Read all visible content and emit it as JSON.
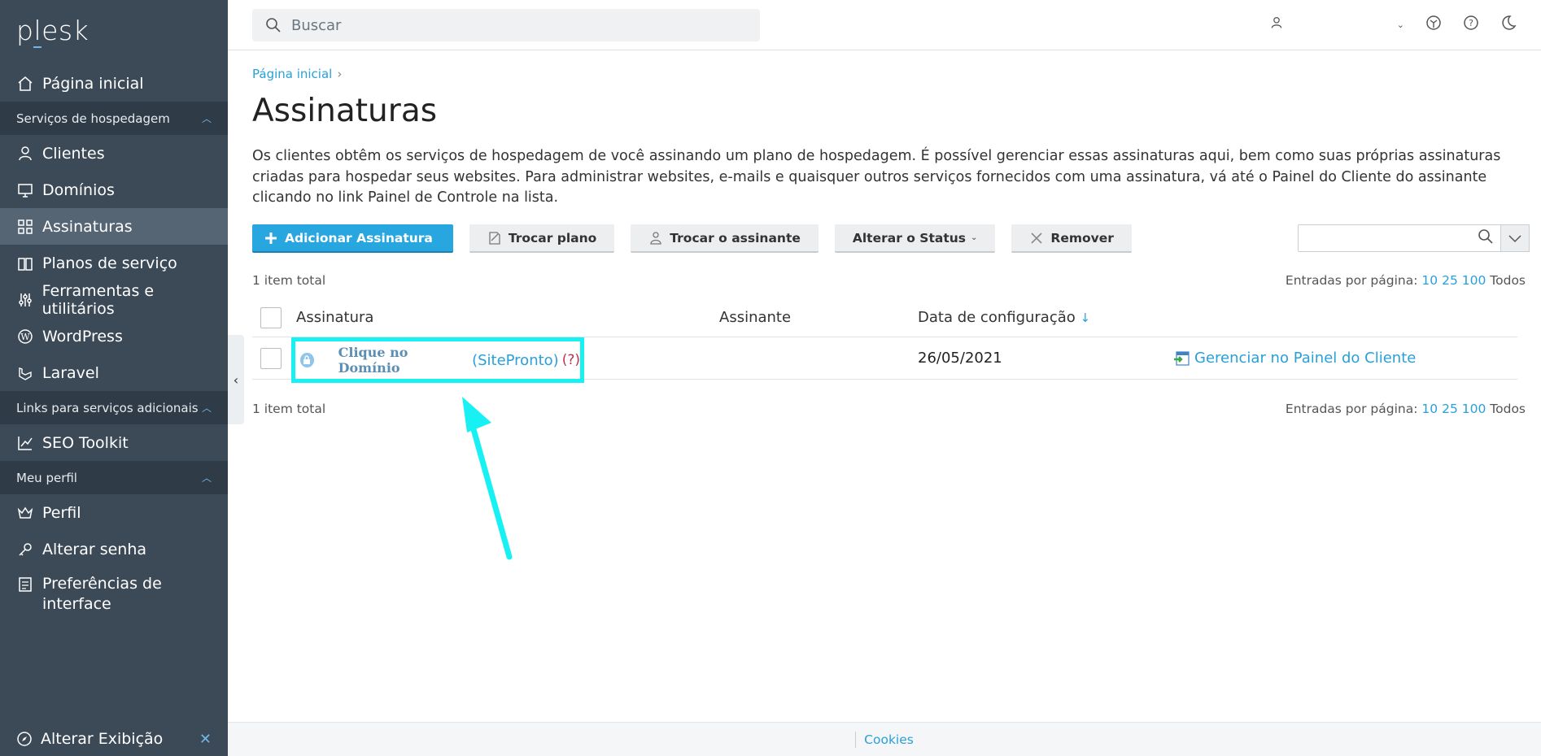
{
  "app": {
    "logo": "plesk"
  },
  "search": {
    "placeholder": "Buscar"
  },
  "sidebar": {
    "home": "Página inicial",
    "group_hosting": "Serviços de hospedagem",
    "clients": "Clientes",
    "domains": "Domínios",
    "subscriptions": "Assinaturas",
    "service_plans": "Planos de serviço",
    "tools": "Ferramentas e utilitários",
    "wordpress": "WordPress",
    "laravel": "Laravel",
    "group_links": "Links para serviços adicionais",
    "seo": "SEO Toolkit",
    "group_profile": "Meu perfil",
    "profile": "Perfil",
    "password": "Alterar senha",
    "prefs_line1": "Preferências de",
    "prefs_line2": "interface",
    "change_view": "Alterar Exibição"
  },
  "breadcrumb": {
    "home": "Página inicial"
  },
  "page": {
    "title": "Assinaturas",
    "description": "Os clientes obtêm os serviços de hospedagem de você assinando um plano de hospedagem. É possível gerenciar essas assinaturas aqui, bem como suas próprias assinaturas criadas para hospedar seus websites. Para administrar websites, e-mails e quaisquer outros serviços fornecidos com uma assinatura, vá até o Painel do Cliente do assinante clicando no link Painel de Controle na lista."
  },
  "toolbar": {
    "add": "Adicionar Assinatura",
    "change_plan": "Trocar plano",
    "change_subscriber": "Trocar o assinante",
    "change_status": "Alterar o Status",
    "remove": "Remover"
  },
  "list": {
    "total_top": "1 item total",
    "total_bottom": "1 item total",
    "per_page_label": "Entradas por página:",
    "per_page_10": "10",
    "per_page_25": "25",
    "per_page_100": "100",
    "per_page_all": "Todos",
    "columns": {
      "subscription": "Assinatura",
      "subscriber": "Assinante",
      "setup_date": "Data de configuração",
      "sort_arrow": "↓"
    },
    "rows": [
      {
        "domain": "Clique no Domínio",
        "plan": "(SitePronto)",
        "plan_help": "(?)",
        "subscriber": "",
        "date": "26/05/2021",
        "manage": "Gerenciar no Painel do Cliente"
      }
    ]
  },
  "footer": {
    "cookies": "Cookies"
  },
  "colors": {
    "sidebar": "#3c4a57",
    "accent": "#28a6e0",
    "highlight": "#17f1f3"
  }
}
